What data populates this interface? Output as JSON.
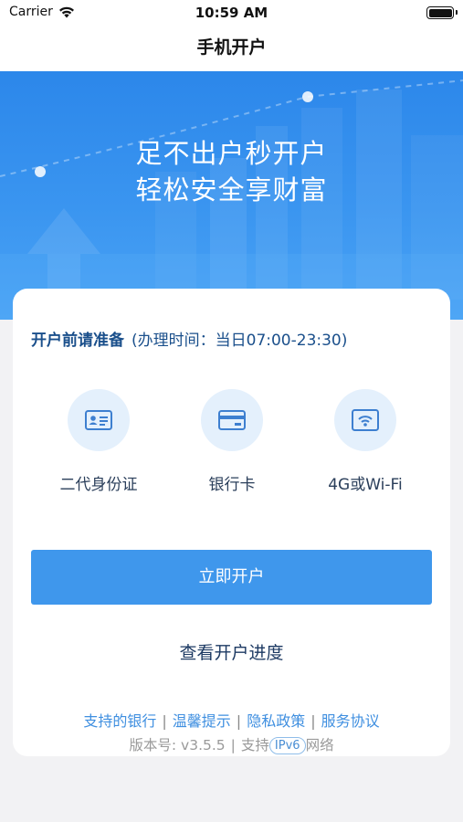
{
  "status_bar": {
    "carrier": "Carrier",
    "time": "10:59 AM"
  },
  "nav": {
    "title": "手机开户"
  },
  "banner": {
    "line1": "足不出户秒开户",
    "line2": "轻松安全享财富"
  },
  "prep": {
    "title": "开户前请准备",
    "hours": "(办理时间：当日07:00-23:30)",
    "items": [
      {
        "label": "二代身份证",
        "icon": "id-card-icon"
      },
      {
        "label": "银行卡",
        "icon": "bank-card-icon"
      },
      {
        "label": "4G或Wi-Fi",
        "icon": "wifi-icon"
      }
    ]
  },
  "actions": {
    "open_button": "立即开户",
    "progress_link": "查看开户进度"
  },
  "footer": {
    "links": [
      "支持的银行",
      "温馨提示",
      "隐私政策",
      "服务协议"
    ],
    "separator": "|",
    "version": "版本号: v3.5.5",
    "support_prefix": "支持",
    "ipv6_badge": "IPv6",
    "support_suffix": "网络"
  },
  "colors": {
    "brand_blue": "#3f97ec",
    "title_navy": "#1a4f8b",
    "link_blue": "#3f8fe0"
  }
}
